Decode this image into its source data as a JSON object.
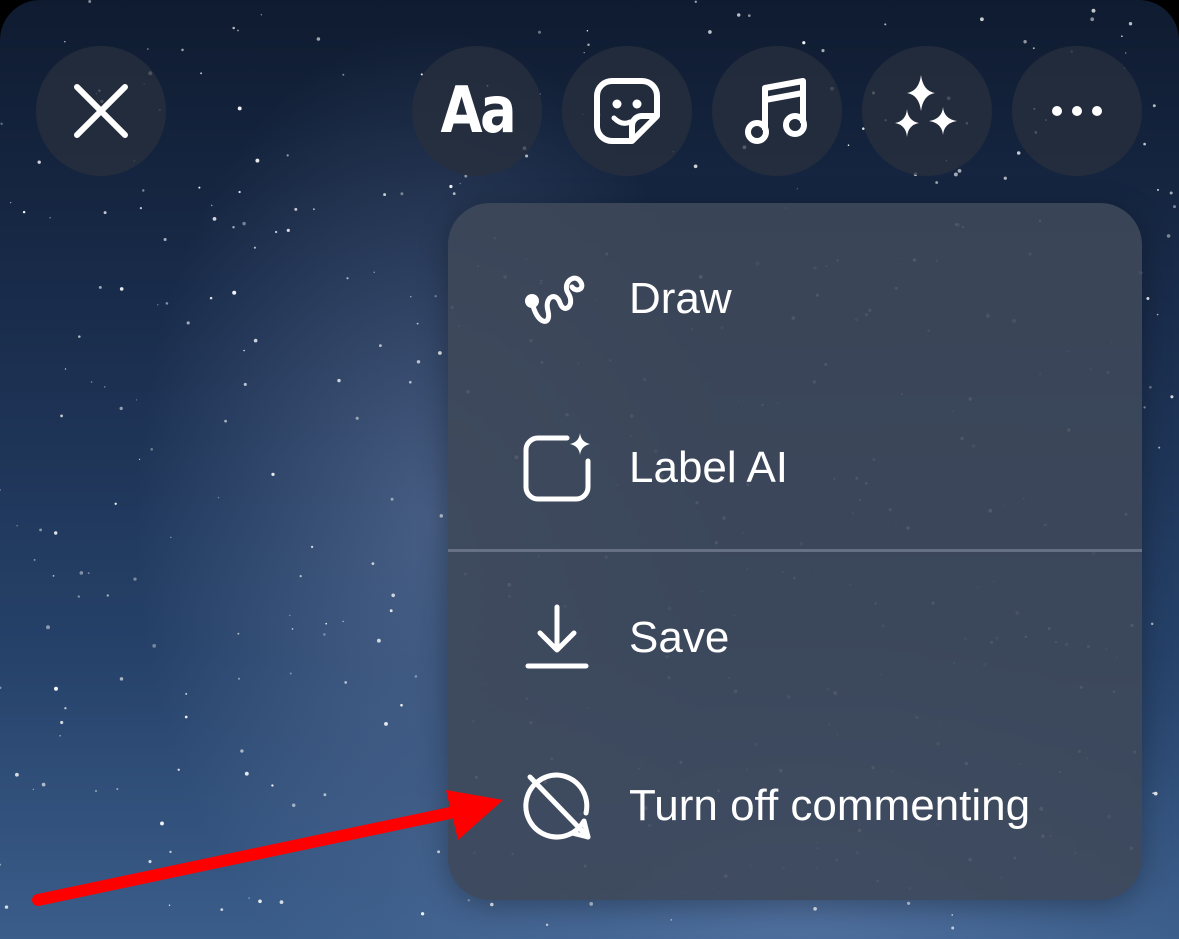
{
  "toolbar": {
    "close_icon": "close-icon",
    "text_tool_label": "Aa",
    "sticker_icon": "sticker-icon",
    "music_icon": "music-note-icon",
    "effects_icon": "sparkles-icon",
    "more_icon": "more-horizontal-icon"
  },
  "menu": {
    "items": [
      {
        "label": "Draw",
        "icon": "draw-squiggle-icon"
      },
      {
        "label": "Label AI",
        "icon": "ai-label-icon"
      },
      {
        "label": "Save",
        "icon": "download-icon"
      },
      {
        "label": "Turn off commenting",
        "icon": "comment-off-icon"
      }
    ]
  },
  "annotation": {
    "arrow_color": "#ff0000"
  },
  "colors": {
    "menu_background": "#3e485a",
    "button_background": "#28303e",
    "icon": "#ffffff"
  }
}
